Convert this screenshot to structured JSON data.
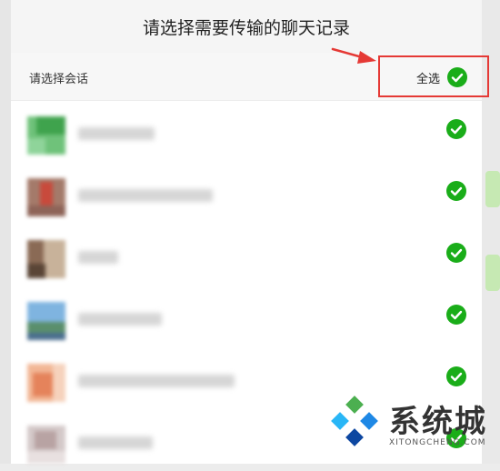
{
  "dialog": {
    "title": "请选择需要传输的聊天记录",
    "header_label": "请选择会话",
    "select_all_label": "全选"
  },
  "conversations": [
    {
      "avatar_colors": [
        "#6fc27a",
        "#3fa34d",
        "#8fd49a"
      ],
      "checked": true
    },
    {
      "avatar_colors": [
        "#a47a6a",
        "#c84a3c",
        "#8e6458"
      ],
      "checked": true
    },
    {
      "avatar_colors": [
        "#8a6a55",
        "#c8b29a",
        "#5a4536"
      ],
      "checked": true
    },
    {
      "avatar_colors": [
        "#7fb4e0",
        "#5a8f6c",
        "#4b6f8f"
      ],
      "checked": true
    },
    {
      "avatar_colors": [
        "#f2b796",
        "#e5835b",
        "#f6d2bc"
      ],
      "checked": true
    },
    {
      "avatar_colors": [
        "#d4c9c9",
        "#b8a3a3",
        "#e8e0e0"
      ],
      "checked": true
    }
  ],
  "watermark": {
    "text": "系统城",
    "domain": "XITONGCHENG.COM",
    "logo_colors": [
      "#1e88e5",
      "#4caf50",
      "#29b6f6",
      "#0d47a1"
    ]
  },
  "colors": {
    "check_green": "#1aad19",
    "highlight_red": "#e53935"
  }
}
